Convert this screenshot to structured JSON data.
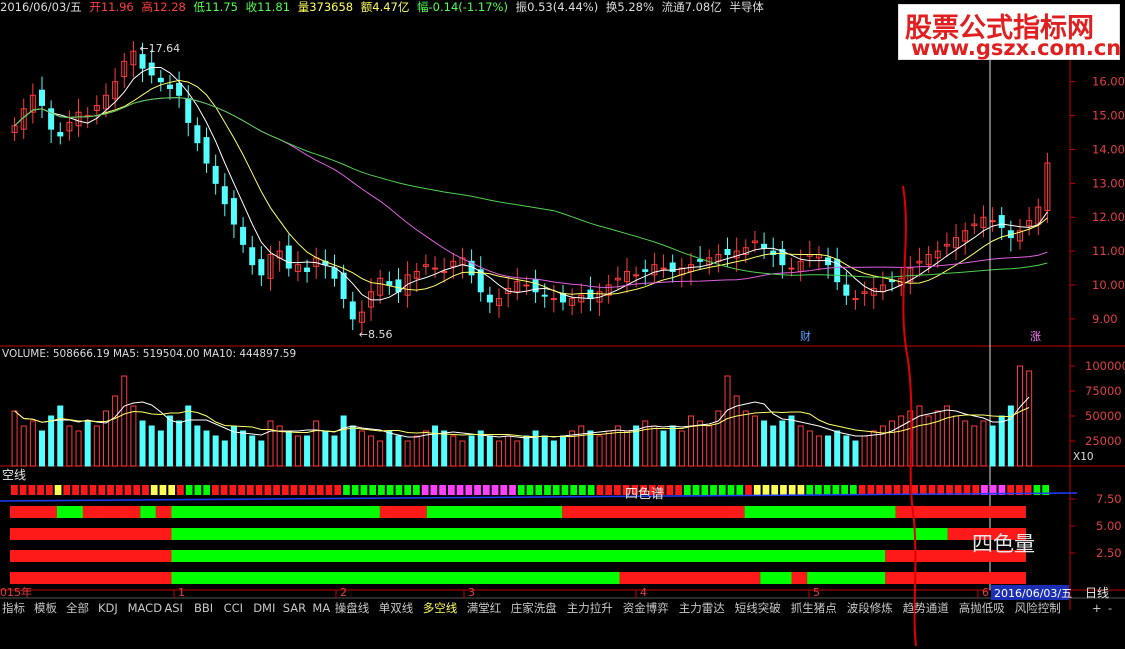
{
  "header": {
    "date": "2016/06/03/五",
    "open_label": "开",
    "open": "11.96",
    "high_label": "高",
    "high": "12.28",
    "low_label": "低",
    "low": "11.75",
    "close_label": "收",
    "close": "11.81",
    "volume_label": "量",
    "volume": "373658",
    "amount_label": "额",
    "amount": "4.47亿",
    "change_label": "幅",
    "change": "-0.14(-1.17%)",
    "amplitude_label": "振",
    "amplitude": "0.53(4.44%)",
    "turnover_label": "换",
    "turnover": "5.28%",
    "float_label": "流通",
    "float": "7.08亿",
    "sector": "半导体"
  },
  "watermark": {
    "line1": "股票公式指标网",
    "line2": "www.gszx.com.cn"
  },
  "colors": {
    "up": "#ff3b3b",
    "down": "#54ffff",
    "ma5": "#ffffff",
    "ma10": "#ffff66",
    "ma30": "#e060e0",
    "ma60": "#50d050",
    "green": "#00ff00",
    "red": "#ff1a1a",
    "magenta": "#ff40ff",
    "yellow": "#ffff55",
    "grid": "#8b0000",
    "axis": "#c00000",
    "annot": "#e00000"
  },
  "chart_data": [
    {
      "type": "candlestick",
      "panel": "price",
      "yticks": [
        "16.00",
        "15.00",
        "14.00",
        "13.00",
        "12.00",
        "11.00",
        "10.00",
        "9.00"
      ],
      "ylim": [
        8.2,
        16.7
      ],
      "high_label": "17.64",
      "low_label": "8.56",
      "event_labels": [
        "财",
        "涨"
      ],
      "close_series": [
        14.7,
        15.2,
        15.6,
        15.3,
        14.6,
        14.4,
        14.8,
        15.1,
        15.0,
        15.3,
        15.6,
        16.0,
        16.6,
        16.9,
        16.4,
        16.2,
        16.0,
        15.8,
        15.6,
        14.8,
        14.2,
        13.6,
        13.0,
        12.4,
        11.8,
        11.2,
        10.6,
        10.3,
        10.9,
        11.0,
        10.5,
        10.6,
        10.4,
        10.8,
        10.6,
        10.2,
        9.6,
        9.0,
        9.2,
        9.8,
        10.2,
        10.0,
        9.8,
        10.3,
        10.4,
        10.6,
        10.5,
        10.4,
        10.7,
        10.8,
        10.3,
        9.8,
        9.5,
        9.6,
        9.9,
        10.1,
        10.0,
        9.8,
        9.7,
        9.6,
        9.5,
        9.6,
        9.7,
        9.6,
        9.8,
        10.0,
        10.2,
        10.4,
        10.3,
        10.4,
        10.6,
        10.5,
        10.4,
        10.5,
        10.6,
        10.7,
        10.8,
        10.9,
        10.9,
        11.0,
        11.1,
        11.3,
        11.1,
        10.9,
        10.6,
        10.5,
        10.7,
        10.9,
        10.9,
        10.6,
        10.1,
        9.7,
        9.6,
        9.8,
        9.9,
        10.0,
        10.1,
        10.2,
        10.5,
        10.7,
        10.9,
        11.0,
        11.2,
        11.4,
        11.6,
        11.8,
        12.0,
        11.9,
        11.7,
        11.4,
        11.6,
        11.9,
        12.3,
        13.6
      ],
      "ma_names": [
        "MA5",
        "MA10",
        "MA30",
        "MA60"
      ]
    },
    {
      "type": "bar",
      "panel": "volume",
      "title": "VOLUME: 508666.19  MA5: 519504.00  MA10: 444897.59",
      "yticks": [
        "100000",
        "75000",
        "50000",
        "25000"
      ],
      "unit": "X10",
      "ylim": [
        0,
        110000
      ],
      "values": [
        55000,
        40000,
        45000,
        35000,
        50000,
        60000,
        40000,
        35000,
        45000,
        40000,
        55000,
        70000,
        90000,
        60000,
        45000,
        40000,
        35000,
        50000,
        45000,
        60000,
        40000,
        35000,
        30000,
        25000,
        40000,
        35000,
        30000,
        25000,
        45000,
        40000,
        35000,
        30000,
        30000,
        45000,
        35000,
        30000,
        50000,
        40000,
        35000,
        30000,
        25000,
        35000,
        30000,
        25000,
        30000,
        35000,
        40000,
        35000,
        30000,
        25000,
        30000,
        35000,
        30000,
        25000,
        30000,
        25000,
        30000,
        35000,
        30000,
        25000,
        30000,
        35000,
        40000,
        35000,
        30000,
        35000,
        40000,
        35000,
        40000,
        45000,
        40000,
        35000,
        40000,
        35000,
        50000,
        45000,
        40000,
        55000,
        90000,
        70000,
        55000,
        50000,
        45000,
        40000,
        45000,
        50000,
        40000,
        35000,
        30000,
        30000,
        35000,
        30000,
        25000,
        30000,
        35000,
        40000,
        45000,
        50000,
        55000,
        60000,
        50000,
        55000,
        60000,
        50000,
        45000,
        40000,
        45000,
        40000,
        50000,
        60000,
        100000,
        95000
      ]
    },
    {
      "type": "heatmap",
      "panel": "signals",
      "title": "空线",
      "row_label_top": "四色谱",
      "row_label_bottom": "四色量",
      "yticks": [
        "7.50",
        "5.00",
        "2.50"
      ],
      "bands": [
        {
          "name": "row1",
          "segments": [
            [
              "red",
              0,
              0.045
            ],
            [
              "green",
              0.045,
              0.07
            ],
            [
              "red",
              0.07,
              0.125
            ],
            [
              "green",
              0.125,
              0.14
            ],
            [
              "red",
              0.14,
              0.155
            ],
            [
              "green",
              0.155,
              0.355
            ],
            [
              "red",
              0.355,
              0.4
            ],
            [
              "green",
              0.4,
              0.53
            ],
            [
              "red",
              0.53,
              0.705
            ],
            [
              "green",
              0.705,
              0.85
            ],
            [
              "red",
              0.85,
              0.975
            ]
          ]
        },
        {
          "name": "row2",
          "segments": [
            [
              "red",
              0,
              0.155
            ],
            [
              "green",
              0.155,
              0.9
            ],
            [
              "red",
              0.9,
              0.975
            ]
          ]
        },
        {
          "name": "row3",
          "segments": [
            [
              "red",
              0,
              0.155
            ],
            [
              "green",
              0.155,
              0.84
            ],
            [
              "red",
              0.84,
              0.975
            ]
          ]
        },
        {
          "name": "row4",
          "segments": [
            [
              "red",
              0,
              0.155
            ],
            [
              "green",
              0.155,
              0.585
            ],
            [
              "red",
              0.585,
              0.72
            ],
            [
              "green",
              0.72,
              0.75
            ],
            [
              "red",
              0.75,
              0.765
            ],
            [
              "green",
              0.765,
              0.84
            ],
            [
              "red",
              0.84,
              0.975
            ]
          ]
        }
      ],
      "spectrum": "rrrrryrrrrrrrrrryyyrgggrrrrrrrrrrrrrrrgggggggggmmmmmmmmmmmgggggggggrrrrrrrrrrgggggggryyyyyyggggggrrrrrrrrrrrrrrmmmrrrgg"
    }
  ],
  "xaxis": {
    "year_label": "015年",
    "months": [
      "1",
      "2",
      "3",
      "4",
      "5",
      "6"
    ],
    "selected_date": "2016/06/03/五",
    "period": "日线"
  },
  "tabs": [
    "指标",
    "模板",
    "全部",
    "KDJ",
    "MACD",
    "ASI",
    "BBI",
    "CCI",
    "DMI",
    "SAR",
    "MA",
    "操盘线",
    "单双线",
    "多空线",
    "满堂红",
    "庄家洗盘",
    "主力拉升",
    "资金博弈",
    "主力雷达",
    "短线突破",
    "抓生猪点",
    "波段修炼",
    "趋势通道",
    "高抛低吸",
    "风险控制"
  ],
  "tab_active": "多空线",
  "nav": {
    "plus": "+",
    "minus": "-"
  }
}
